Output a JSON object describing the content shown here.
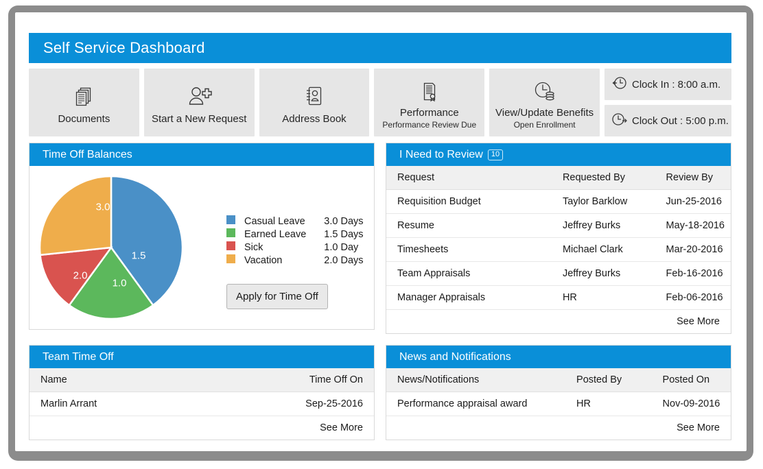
{
  "banner": {
    "title": "Self Service Dashboard"
  },
  "colors": {
    "accent": "#0a8fd8",
    "tile_bg": "#e6e6e6",
    "link": "#2e7ebb",
    "pie_blue": "#4a90c7",
    "pie_green": "#5cb85c",
    "pie_red": "#d9534f",
    "pie_orange": "#efad4b"
  },
  "tiles": [
    {
      "icon": "documents-icon",
      "label": "Documents",
      "sub": ""
    },
    {
      "icon": "add-user-icon",
      "label": "Start a New Request",
      "sub": ""
    },
    {
      "icon": "address-book-icon",
      "label": "Address Book",
      "sub": ""
    },
    {
      "icon": "certificate-icon",
      "label": "Performance",
      "sub": "Performance Review Due"
    },
    {
      "icon": "clock-coins-icon",
      "label": "View/Update Benefits",
      "sub": "Open Enrollment"
    }
  ],
  "clock": {
    "in": {
      "icon": "clock-in-icon",
      "label": "Clock In : 8:00 a.m."
    },
    "out": {
      "icon": "clock-out-icon",
      "label": "Clock Out : 5:00 p.m."
    }
  },
  "time_off": {
    "title": "Time Off Balances",
    "apply_label": "Apply for Time Off",
    "legend": [
      {
        "name": "Casual Leave",
        "value": "3.0 Days",
        "color": "#4a90c7"
      },
      {
        "name": "Earned Leave",
        "value": "1.5 Days",
        "color": "#5cb85c"
      },
      {
        "name": "Sick",
        "value": "1.0 Day",
        "color": "#d9534f"
      },
      {
        "name": "Vacation",
        "value": "2.0 Days",
        "color": "#efad4b"
      }
    ]
  },
  "chart_data": {
    "type": "pie",
    "title": "Time Off Balances",
    "unit": "Days",
    "total": 7.5,
    "start_angle_deg": 0,
    "direction": "clockwise",
    "labels": [
      "Casual Leave",
      "Earned Leave",
      "Sick",
      "Vacation"
    ],
    "values": [
      3.0,
      1.5,
      1.0,
      2.0
    ],
    "value_labels": [
      "3.0",
      "1.5",
      "1.0",
      "2.0"
    ],
    "legend_values": [
      "3.0 Days",
      "1.5 Days",
      "1.0 Day",
      "2.0 Days"
    ],
    "colors": [
      "#4a90c7",
      "#5cb85c",
      "#d9534f",
      "#efad4b"
    ],
    "legend_position": "right",
    "grid": false
  },
  "review": {
    "title": "I Need to Review",
    "badge": "10",
    "columns": [
      "Request",
      "Requested By",
      "Review By"
    ],
    "rows": [
      {
        "request": "Requisition Budget",
        "by": "Taylor Barklow",
        "date": "Jun-25-2016"
      },
      {
        "request": "Resume",
        "by": "Jeffrey Burks",
        "date": "May-18-2016"
      },
      {
        "request": "Timesheets",
        "by": "Michael Clark",
        "date": "Mar-20-2016"
      },
      {
        "request": "Team Appraisals",
        "by": "Jeffrey Burks",
        "date": "Feb-16-2016"
      },
      {
        "request": "Manager Appraisals",
        "by": "HR",
        "date": "Feb-06-2016"
      }
    ],
    "see_more": "See More"
  },
  "team_time_off": {
    "title": "Team Time Off",
    "columns": [
      "Name",
      "Time Off On"
    ],
    "rows": [
      {
        "name": "Marlin Arrant",
        "date": "Sep-25-2016"
      }
    ],
    "see_more": "See More"
  },
  "news": {
    "title": "News and Notifications",
    "columns": [
      "News/Notifications",
      "Posted By",
      "Posted On"
    ],
    "rows": [
      {
        "text": "Performance appraisal award",
        "by": "HR",
        "date": "Nov-09-2016"
      }
    ],
    "see_more": "See More"
  }
}
